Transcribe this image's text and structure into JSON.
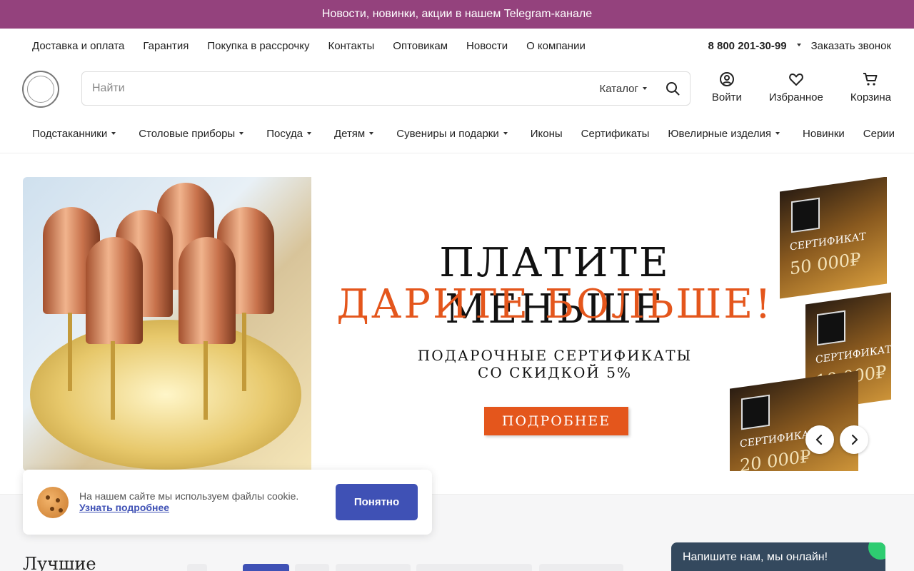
{
  "topbar": {
    "text": "Новости, новинки, акции в нашем Telegram-канале"
  },
  "infobar": {
    "links": [
      "Доставка и оплата",
      "Гарантия",
      "Покупка в рассрочку",
      "Контакты",
      "Оптовикам",
      "Новости",
      "О компании"
    ],
    "phone": "8 800 201-30-99",
    "callback": "Заказать звонок"
  },
  "header": {
    "search_placeholder": "Найти",
    "catalog_label": "Каталог",
    "login": "Войти",
    "favorites": "Избранное",
    "cart": "Корзина"
  },
  "catnav": {
    "items": [
      {
        "label": "Подстаканники",
        "dropdown": true
      },
      {
        "label": "Столовые приборы",
        "dropdown": true
      },
      {
        "label": "Посуда",
        "dropdown": true
      },
      {
        "label": "Детям",
        "dropdown": true
      },
      {
        "label": "Сувениры и подарки",
        "dropdown": true
      },
      {
        "label": "Иконы",
        "dropdown": false
      },
      {
        "label": "Сертификаты",
        "dropdown": false
      },
      {
        "label": "Ювелирные изделия",
        "dropdown": true
      },
      {
        "label": "Новинки",
        "dropdown": false
      },
      {
        "label": "Серии",
        "dropdown": false
      }
    ],
    "more": "···"
  },
  "banner": {
    "line1": "ПЛАТИТЕ МЕНЬШЕ",
    "line2": "ДАРИТЕ БОЛЬШЕ!",
    "sub1": "ПОДАРОЧНЫЕ СЕРТИФИКАТЫ",
    "sub2": "СО СКИДКОЙ 5%",
    "button": "ПОДРОБНЕЕ",
    "cards": [
      {
        "title": "СЕРТИФИКАТ",
        "amount": "50 000₽"
      },
      {
        "title": "СЕРТИФИКАТ",
        "amount": "10 000₽"
      },
      {
        "title": "СЕРТИФИКАТ",
        "amount": "20 000₽"
      }
    ]
  },
  "section": {
    "title": "Лучшие"
  },
  "cookie": {
    "text": "На нашем сайте мы используем файлы cookie.",
    "link": "Узнать подробнее",
    "button": "Понятно"
  },
  "chat": {
    "text": "Напишите нам, мы онлайн!"
  },
  "colors": {
    "topbar": "#94427d",
    "accent": "#3f51b5",
    "banner_orange": "#e4561c",
    "chat": "#34495e"
  }
}
